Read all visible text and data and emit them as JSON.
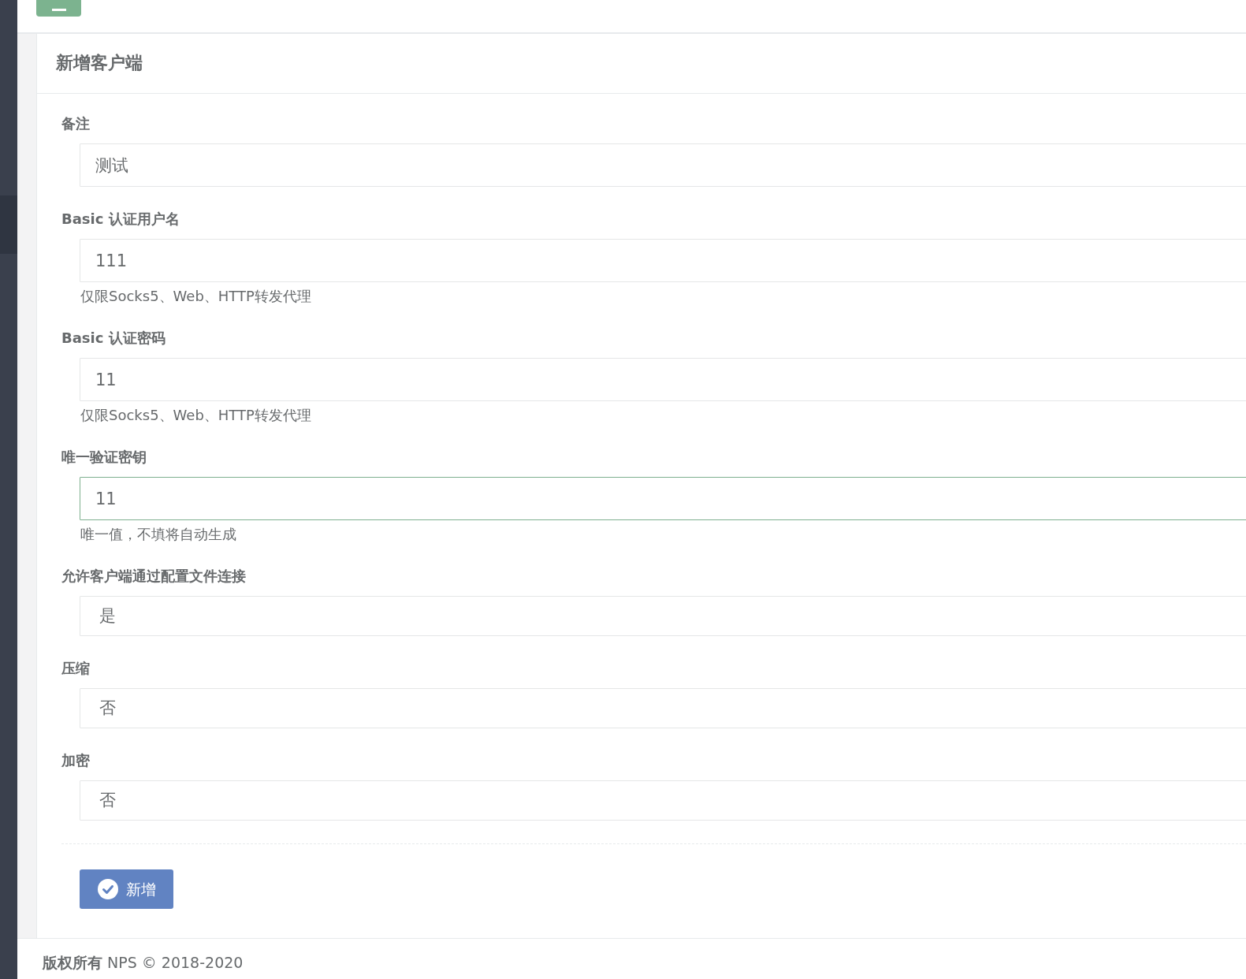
{
  "panel": {
    "title": "新增客户端"
  },
  "fields": [
    {
      "kind": "input",
      "label": "备注",
      "value": "测试",
      "focused": false
    },
    {
      "kind": "input",
      "label": "Basic 认证用户名",
      "value": "111",
      "help": "仅限Socks5、Web、HTTP转发代理",
      "focused": false
    },
    {
      "kind": "input",
      "label": "Basic 认证密码",
      "value": "11",
      "help": "仅限Socks5、Web、HTTP转发代理",
      "focused": false
    },
    {
      "kind": "input",
      "label": "唯一验证密钥",
      "value": "11",
      "help": "唯一值，不填将自动生成",
      "focused": true
    },
    {
      "kind": "select",
      "label": "允许客户端通过配置文件连接",
      "value": "是",
      "focused": false
    },
    {
      "kind": "select",
      "label": "压缩",
      "value": "否",
      "focused": false
    },
    {
      "kind": "select",
      "label": "加密",
      "value": "否",
      "focused": false
    }
  ],
  "submit_button": {
    "label": "新增"
  },
  "footer": {
    "text": "**版权所有** NPS © 2018-2020"
  }
}
